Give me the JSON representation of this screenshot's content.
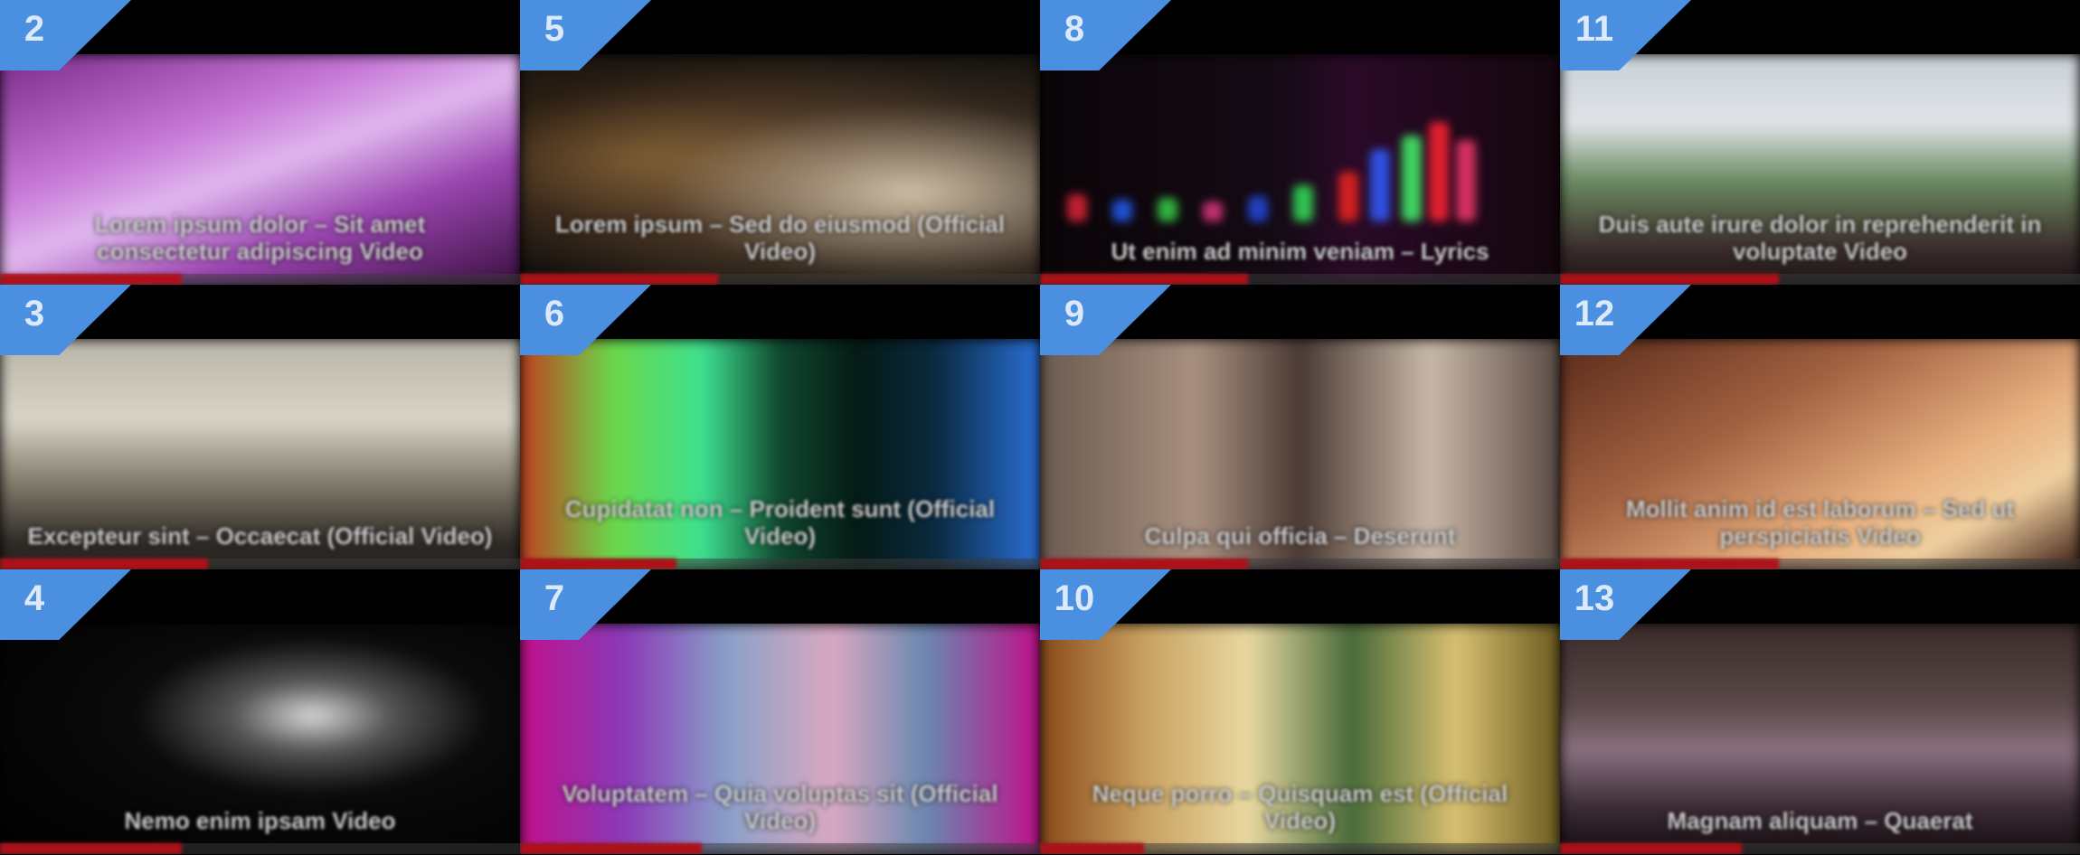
{
  "page": {
    "background": "#000000",
    "badge_color": "#4a8fe0",
    "progress_color": "#b01018"
  },
  "tiles": [
    {
      "number": "2",
      "title": "Lorem ipsum dolor – Sit amet consectetur adipiscing Video",
      "progress": 0.35
    },
    {
      "number": "5",
      "title": "Lorem ipsum – Sed do eiusmod (Official Video)",
      "progress": 0.38
    },
    {
      "number": "8",
      "title": "Ut enim ad minim veniam – Lyrics",
      "progress": 0.4
    },
    {
      "number": "11",
      "title": "Duis aute irure dolor in reprehenderit in voluptate Video",
      "progress": 0.42
    },
    {
      "number": "3",
      "title": "Excepteur sint – Occaecat (Official Video)",
      "progress": 0.4
    },
    {
      "number": "6",
      "title": "Cupidatat non – Proident sunt (Official Video)",
      "progress": 0.3
    },
    {
      "number": "9",
      "title": "Culpa qui officia – Deserunt",
      "progress": 0.4
    },
    {
      "number": "12",
      "title": "Mollit anim id est laborum – Sed ut perspiciatis Video",
      "progress": 0.42
    },
    {
      "number": "4",
      "title": "Nemo enim ipsam Video",
      "progress": 0.35
    },
    {
      "number": "7",
      "title": "Voluptatem – Quia voluptas sit (Official Video)",
      "progress": 0.35
    },
    {
      "number": "10",
      "title": "Neque porro – Quisquam est (Official Video)",
      "progress": 0.2
    },
    {
      "number": "13",
      "title": "Magnam aliquam – Quaerat",
      "progress": 0.35
    }
  ]
}
